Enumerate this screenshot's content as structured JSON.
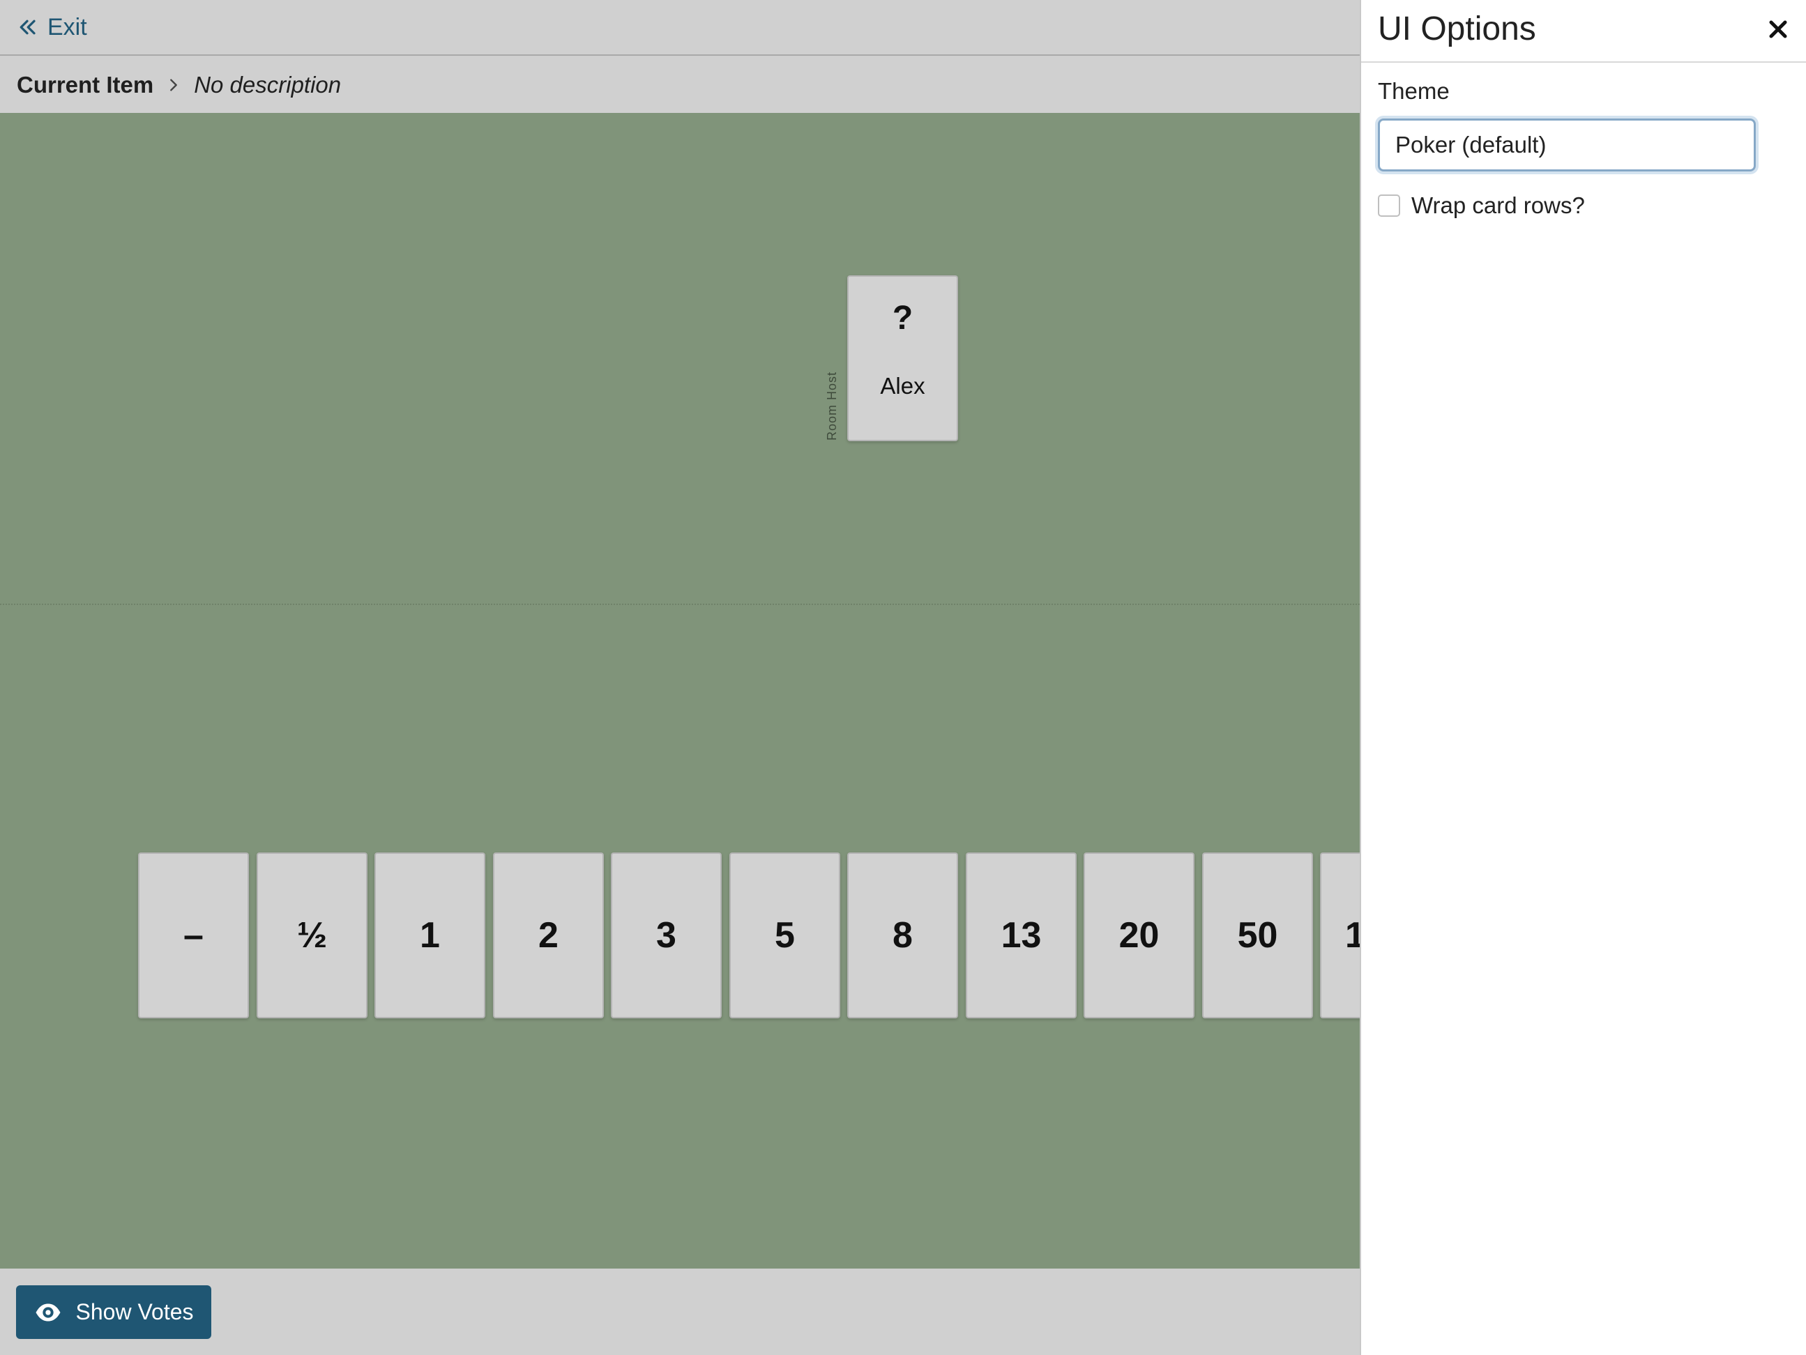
{
  "header": {
    "exit_label": "Exit"
  },
  "breadcrumb": {
    "current": "Current Item",
    "description": "No description"
  },
  "table": {
    "players": [
      {
        "name": "Alex",
        "role": "Room Host",
        "vote": "?"
      }
    ]
  },
  "hand": {
    "cards": [
      "–",
      "½",
      "1",
      "2",
      "3",
      "5",
      "8",
      "13",
      "20",
      "50",
      "1"
    ]
  },
  "footer": {
    "show_votes_label": "Show Votes"
  },
  "ui_options": {
    "title": "UI Options",
    "theme_label": "Theme",
    "theme_value": "Poker (default)",
    "wrap_label": "Wrap card rows?",
    "wrap_checked": false
  },
  "colors": {
    "table": "#80947a",
    "accent": "#1f5673",
    "card": "#d2d2d2",
    "chrome": "#d0d0d0"
  },
  "icons": {
    "exit": "double-chevron-left-icon",
    "breadcrumb_separator": "chevron-right-icon",
    "show_votes": "eye-icon",
    "close": "close-icon"
  }
}
